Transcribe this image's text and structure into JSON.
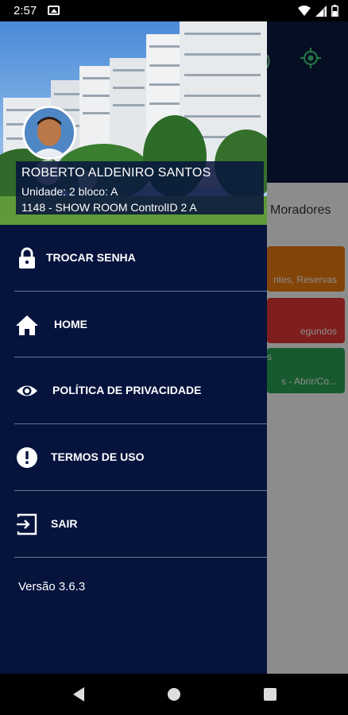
{
  "status_bar": {
    "time": "2:57"
  },
  "background_app": {
    "tab_label": "Moradores",
    "cards": [
      {
        "text": "ntes, Reservas",
        "color": "#ef7d0f"
      },
      {
        "text": "egundos",
        "color": "#e53935"
      },
      {
        "title": "s",
        "text": "s - Abrir/Co...",
        "color": "#2ba455"
      }
    ]
  },
  "drawer": {
    "user": {
      "name": "ROBERTO ALDENIRO SANTOS",
      "unit": "Unidade: 2 bloco: A",
      "place": "1148 - SHOW ROOM ControlID 2 A"
    },
    "menu": [
      {
        "label": "TROCAR SENHA",
        "icon": "lock-icon"
      },
      {
        "label": "HOME",
        "icon": "home-icon"
      },
      {
        "label": "POLÍTICA DE PRIVACIDADE",
        "icon": "eye-icon"
      },
      {
        "label": "TERMOS DE USO",
        "icon": "alert-icon"
      },
      {
        "label": "SAIR",
        "icon": "logout-icon"
      }
    ],
    "version": "Versão 3.6.3"
  },
  "colors": {
    "drawer_bg": "#05133d",
    "header_bg": "#0a1a3f",
    "accent_green": "#3fd17a"
  }
}
